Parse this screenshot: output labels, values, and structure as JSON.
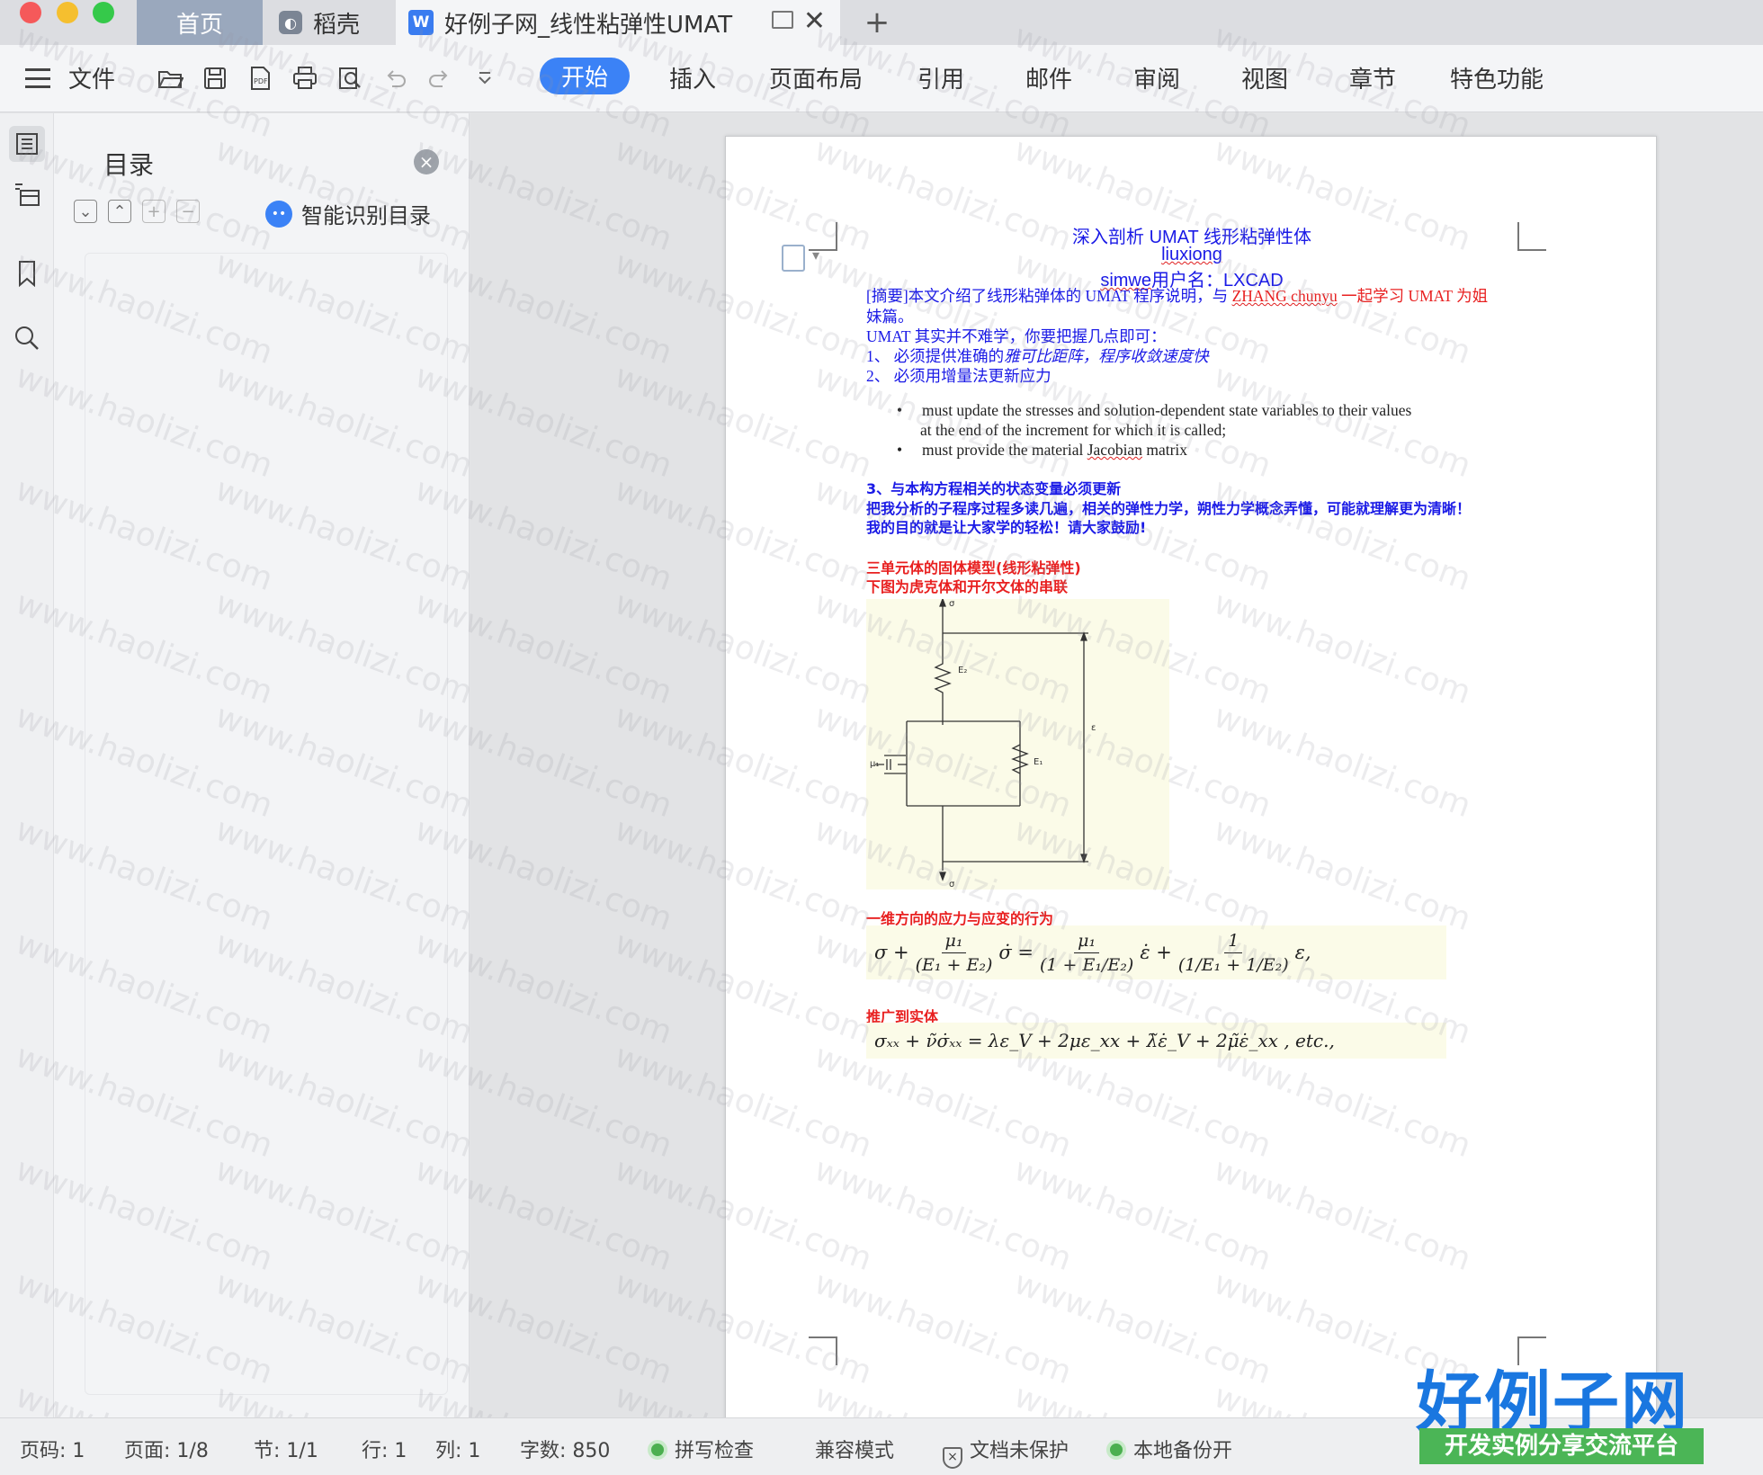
{
  "tabs": {
    "home": "首页",
    "daoke": "稻壳",
    "document": "好例子网_线性粘弹性UMAT"
  },
  "toolbar": {
    "file": "文件",
    "menus": [
      "开始",
      "插入",
      "页面布局",
      "引用",
      "邮件",
      "审阅",
      "视图",
      "章节",
      "特色功能"
    ],
    "active_menu": "开始",
    "accent_color": "#3b82f6"
  },
  "toc": {
    "title": "目录",
    "smart_label": "智能识别目录"
  },
  "document": {
    "title": "深入剖析 UMAT 线形粘弹性体",
    "author": "liuxiong",
    "user_prefix": "simwe",
    "user_label": "用户名：",
    "user_name": "LXCAD",
    "abstract_a": "[摘要]本文介绍了线形粘弹体的 UMAT 程序说明，与 ",
    "abstract_red": "ZHANG chunyu",
    "abstract_b": " 一起学习 UMAT 为姐",
    "abstract_c": "妹篇。",
    "intro": "UMAT 其实并不难学，你要把握几点即可：",
    "point1_a": "1、 必须提供准确的",
    "point1_b": "雅可比距阵，程序收敛速度快",
    "point2": "2、 必须用增量法更新应力",
    "bullet1_a": "must update the stresses and solution-dependent state variables to their values",
    "bullet1_b": "at the end of the increment for which it is called;",
    "bullet2_a": "must provide the material ",
    "bullet2_b": "Jacobian",
    "bullet2_c": " matrix",
    "point3": "3、与本构方程相关的状态变量必须更新",
    "advice1": "把我分析的子程序过程多读几遍，相关的弹性力学，朔性力学概念弄懂，可能就理解更为清晰！",
    "advice2": "我的目的就是让大家学的轻松！请大家鼓励!",
    "sec1_title": "三单元体的固体模型(线形粘弹性)",
    "sec1_sub": "下图为虎克体和开尔文体的串联",
    "fig_labels": {
      "sigma_top": "σ",
      "sigma_bottom": "σ",
      "E2": "E₂",
      "E1": "E₁",
      "mu1": "μ₁",
      "eps": "ε"
    },
    "sec2_title": "一维方向的应力与应变的行为",
    "eq1": {
      "lhs": "σ +",
      "f1_num": "μ₁",
      "f1_den": "(E₁ + E₂)",
      "mid": "σ̇ =",
      "f2_num": "μ₁",
      "f2_den": "(1 + E₁/E₂)",
      "mid2": "ε̇ +",
      "f3_num": "1",
      "f3_den": "(1/E₁ + 1/E₂)",
      "tail": "ε,"
    },
    "sec3_title": "推广到实体",
    "eq2": "σₓₓ + ν̃σ̇ₓₓ = λε_V + 2με_xx + λ̃ε̇_V + 2μ̃ε̇_xx ,    etc.,"
  },
  "status": {
    "page_code": "页码: 1",
    "pages": "页面: 1/8",
    "section": "节: 1/1",
    "row": "行: 1",
    "col": "列: 1",
    "words": "字数: 850",
    "spell": "拼写检查",
    "compat": "兼容模式",
    "protect": "文档未保护",
    "backup": "本地备份开"
  },
  "watermark": "www.haolizi.com",
  "brand": {
    "main": "好例子网",
    "sub": "开发实例分享交流平台"
  }
}
